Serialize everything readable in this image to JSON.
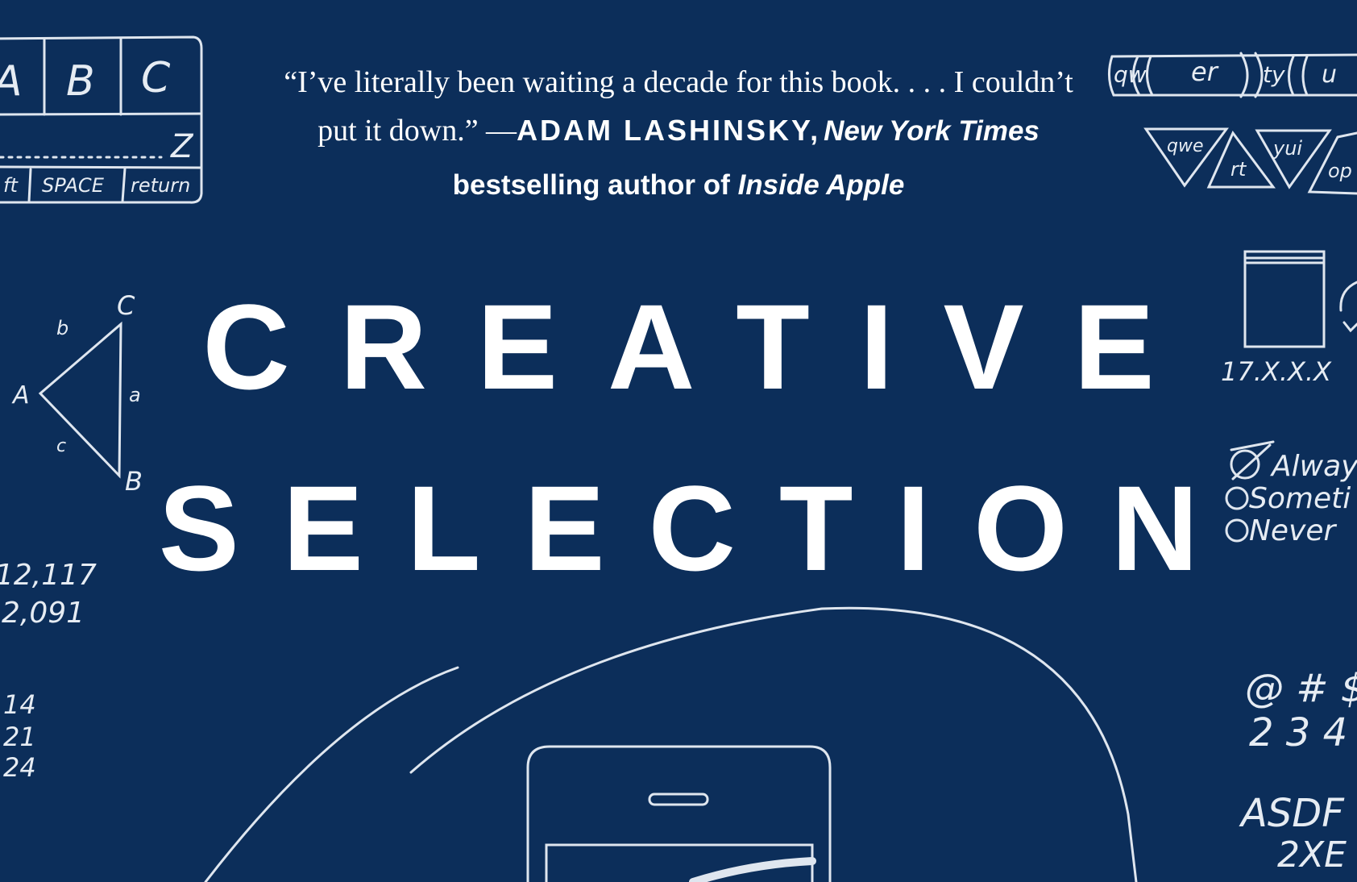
{
  "quote": {
    "line1": "“I’ve literally been waiting a decade for this book. . . . I couldn’t",
    "line2_start": "put it down.” —",
    "author": "ADAM LASHINSKY,",
    "source": "New York Times",
    "line3_start": "bestselling author of",
    "book": "Inside Apple"
  },
  "title": {
    "line1": "CREATIVE",
    "line2": "SELECTION"
  },
  "doodles": {
    "keyboard_letters": [
      "A",
      "B",
      "C"
    ],
    "keyboard_z": "Z",
    "keyboard_bottom": [
      "ft",
      "SPACE",
      "return"
    ],
    "triangle_labels": {
      "C": "C",
      "b": "b",
      "A": "A",
      "a": "a",
      "c": "c",
      "B": "B"
    },
    "numbers_left": [
      "12,117",
      "2,091"
    ],
    "fractions_left": [
      "14",
      "21",
      "24"
    ],
    "keys_top_right": [
      "qw",
      "er",
      "ty",
      "u"
    ],
    "triangle_keys": [
      "qwe",
      "rt",
      "yui",
      "op"
    ],
    "ip_address": "17.X.X.X",
    "options": [
      "Alway",
      "Someti",
      "Never"
    ],
    "symbols": "@ # $",
    "digits": "2 3 4",
    "letters_asdf": "ASDF",
    "letters_2xe": "2XE"
  },
  "colors": {
    "background": "#0c2e5a",
    "text": "#ffffff",
    "sketch": "#dfe6ef"
  }
}
